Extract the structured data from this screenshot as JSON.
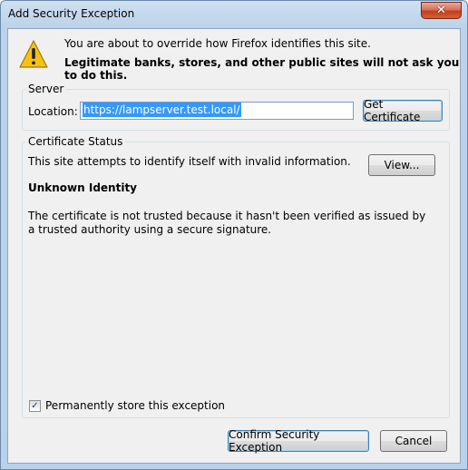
{
  "window": {
    "title": "Add Security Exception",
    "close_glyph": "✕"
  },
  "intro": {
    "icon": "warning-icon",
    "line1": "You are about to override how Firefox identifies this site.",
    "line2": "Legitimate banks, stores, and other public sites will not ask you to do this."
  },
  "server": {
    "group_title": "Server",
    "location_label": "Location:",
    "location_value": "https://lampserver.test.local/",
    "get_certificate_button": "Get Certificate"
  },
  "certificate_status": {
    "group_title": "Certificate Status",
    "message": "This site attempts to identify itself with invalid information.",
    "view_button": "View...",
    "heading": "Unknown Identity",
    "description": "The certificate is not trusted because it hasn't been verified as issued by a trusted authority using a secure signature."
  },
  "permanent_store": {
    "checked": true,
    "label": "Permanently store this exception"
  },
  "buttons": {
    "confirm": "Confirm Security Exception",
    "cancel": "Cancel"
  },
  "colors": {
    "selection": "#3399ff",
    "dialog_bg": "#f0f0f0",
    "close_button": "#c1401f"
  }
}
